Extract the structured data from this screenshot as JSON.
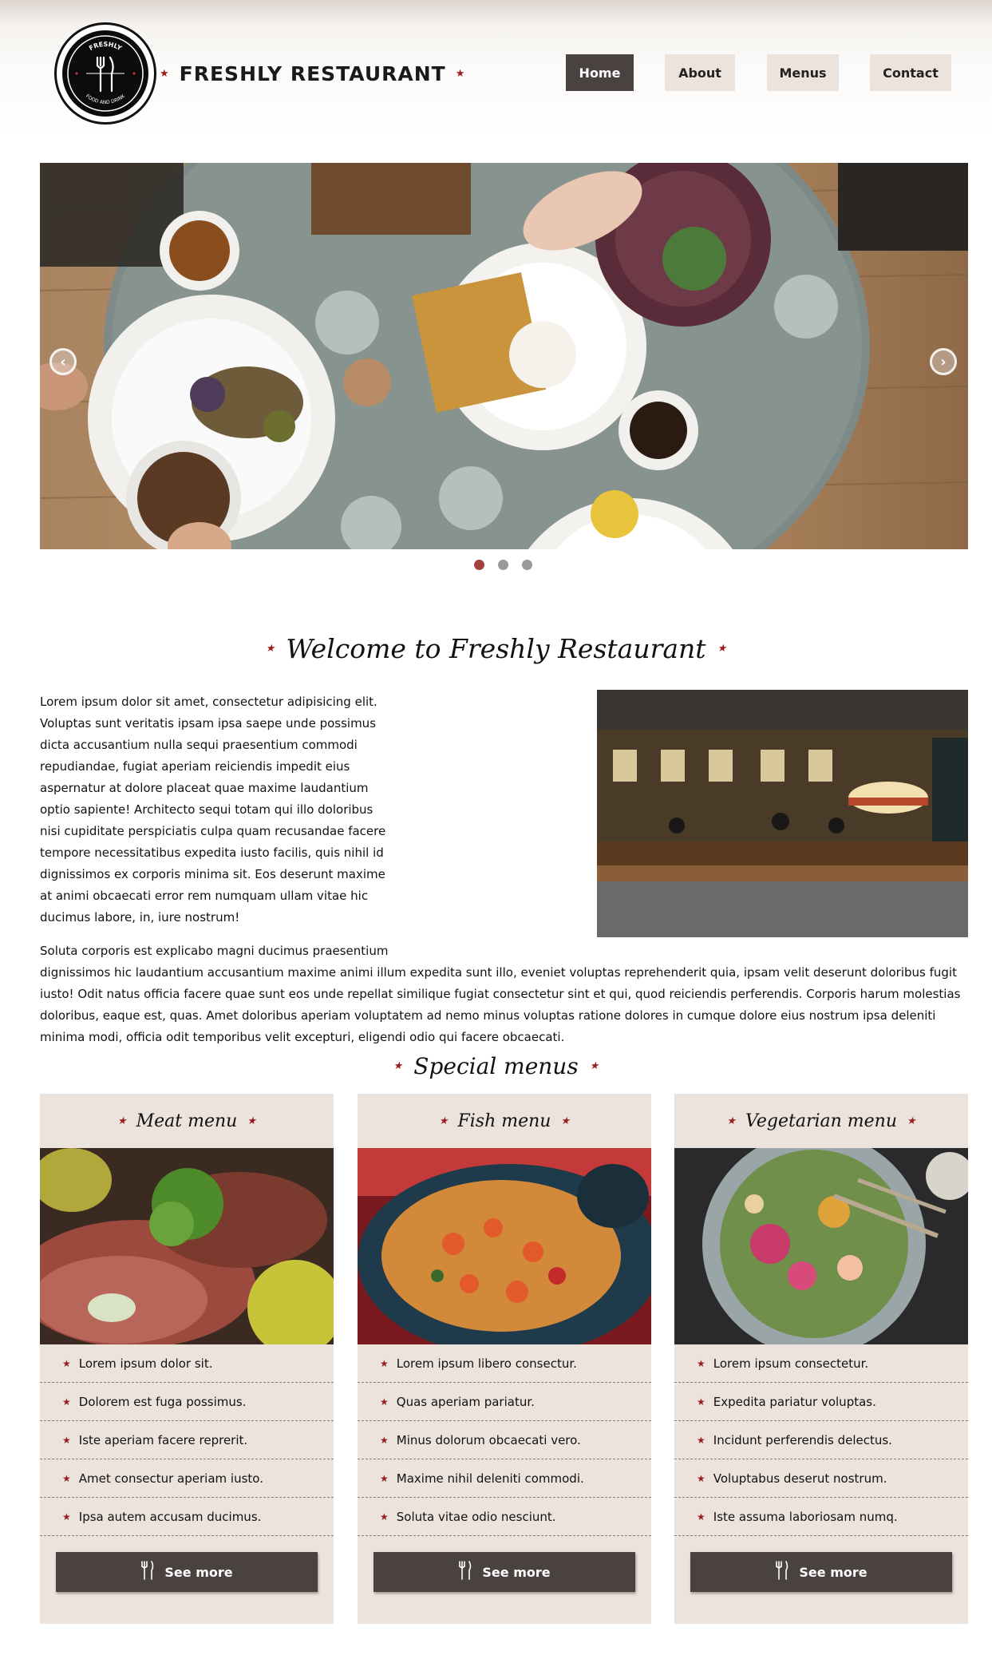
{
  "header": {
    "logo": {
      "top_text": "FRESHLY",
      "bottom_text": "FOOD AND DRINK",
      "icon": "fork-knife-icon"
    },
    "brand": "FRESHLY RESTAURANT",
    "nav": [
      {
        "label": "Home",
        "active": true
      },
      {
        "label": "About",
        "active": false
      },
      {
        "label": "Menus",
        "active": false
      },
      {
        "label": "Contact",
        "active": false
      }
    ]
  },
  "slider": {
    "prev_icon": "chevron-left-icon",
    "next_icon": "chevron-right-icon",
    "slides": 3,
    "active_slide": 1
  },
  "welcome": {
    "title": "Welcome to Freshly Restaurant",
    "paragraphs": [
      "Lorem ipsum dolor sit amet, consectetur adipisicing elit. Voluptas sunt veritatis ipsam ipsa saepe unde possimus dicta accusantium nulla sequi praesentium commodi repudiandae, fugiat aperiam reiciendis impedit eius aspernatur at dolore placeat quae maxime laudantium optio sapiente! Architecto sequi totam qui illo doloribus nisi cupiditate perspiciatis culpa quam recusandae facere tempore necessitatibus expedita iusto facilis, quis nihil id dignissimos ex corporis minima sit. Eos deserunt maxime at animi obcaecati error rem numquam ullam vitae hic ducimus labore, in, iure nostrum!",
      "Soluta corporis est explicabo magni ducimus praesentium dignissimos hic laudantium accusantium maxime animi illum expedita sunt illo, eveniet voluptas reprehenderit quia, ipsam velit deserunt doloribus fugit iusto! Odit natus officia facere quae sunt eos unde repellat similique fugiat consectetur sint et qui, quod reiciendis perferendis. Corporis harum molestias doloribus, eaque est, quas. Amet doloribus aperiam voluptatem ad nemo minus voluptas ratione dolores in cumque dolore eius nostrum ipsa deleniti minima modi, officia odit temporibus velit excepturi, eligendi odio qui facere obcaecati."
    ]
  },
  "special": {
    "title": "Special menus",
    "cards": [
      {
        "title": "Meat menu",
        "items": [
          "Lorem ipsum dolor sit.",
          "Dolorem est fuga possimus.",
          "Iste aperiam facere reprerit.",
          "Amet consectur aperiam iusto.",
          "Ipsa autem accusam ducimus."
        ],
        "button": "See more"
      },
      {
        "title": "Fish menu",
        "items": [
          "Lorem ipsum libero consectur.",
          "Quas aperiam pariatur.",
          "Minus dolorum obcaecati vero.",
          "Maxime nihil deleniti commodi.",
          "Soluta vitae odio nesciunt."
        ],
        "button": "See more"
      },
      {
        "title": "Vegetarian menu",
        "items": [
          "Lorem ipsum consectetur.",
          "Expedita pariatur voluptas.",
          "Incidunt perferendis delectus.",
          "Voluptabus deserut nostrum.",
          "Iste assuma laboriosam numq."
        ],
        "button": "See more"
      }
    ]
  },
  "colors": {
    "accent": "#9b1c1c",
    "nav_active": "#4a4240",
    "nav_bg": "#ece3dc",
    "card_bg": "#ece3dc",
    "button_bg": "#4a4240",
    "dot_active": "#a5413d"
  }
}
